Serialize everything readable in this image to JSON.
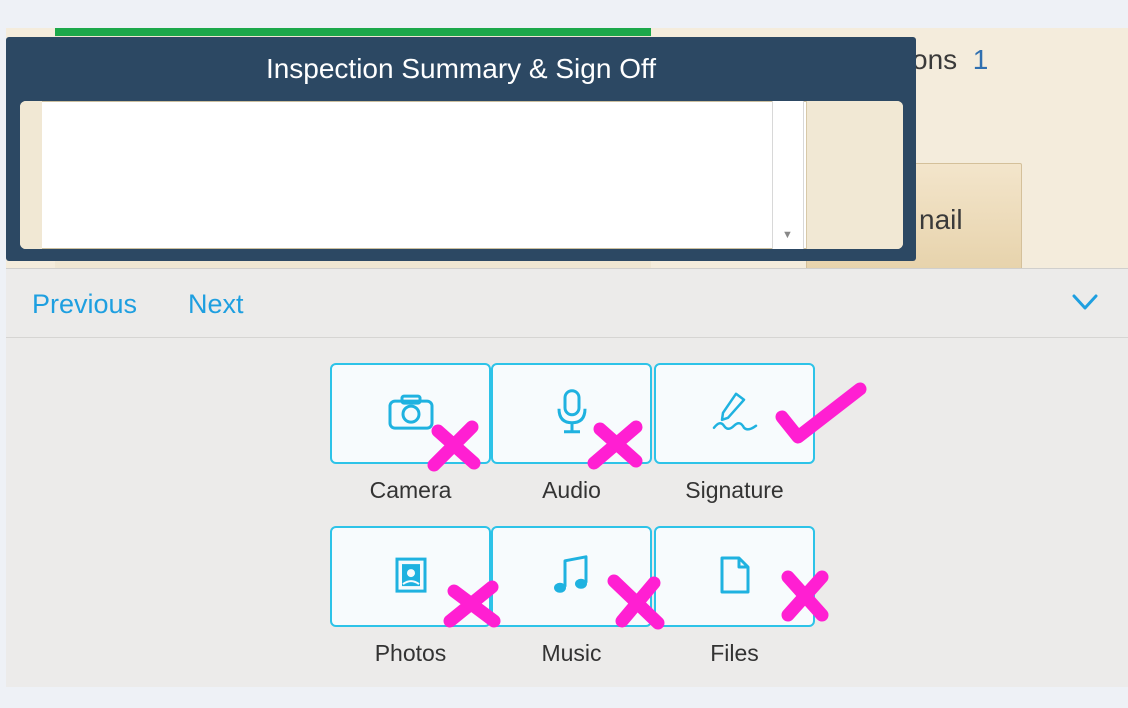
{
  "background": {
    "partial_heading": "ons",
    "partial_count": "1",
    "email_button_partial": "nail"
  },
  "popover": {
    "title": "Inspection Summary & Sign Off",
    "text_value": ""
  },
  "accessory": {
    "previous_label": "Previous",
    "next_label": "Next",
    "collapse_icon": "chevron-down-icon"
  },
  "attachments": [
    {
      "label": "Camera",
      "icon": "camera-icon",
      "mark": "cross"
    },
    {
      "label": "Audio",
      "icon": "microphone-icon",
      "mark": "cross"
    },
    {
      "label": "Signature",
      "icon": "signature-pen-icon",
      "mark": "check"
    },
    {
      "label": "Photos",
      "icon": "photo-icon",
      "mark": "cross"
    },
    {
      "label": "Music",
      "icon": "music-note-icon",
      "mark": "cross"
    },
    {
      "label": "Files",
      "icon": "file-icon",
      "mark": "cross"
    }
  ],
  "colors": {
    "accent": "#1e9fe0",
    "tile_border": "#2dc3e8",
    "popover_bg": "#2c4863",
    "annotation": "#ff1fd2",
    "progress_green": "#1ca84a"
  }
}
